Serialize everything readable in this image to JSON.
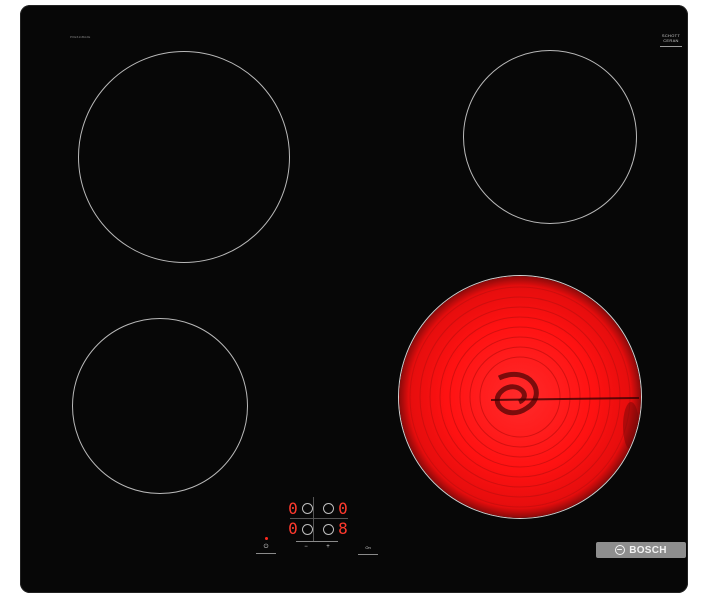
{
  "hob": {
    "model_code": "PKE611BA2E",
    "glass_brand_line1": "SCHOTT",
    "glass_brand_line2": "CERAN",
    "brand": "BOSCH",
    "heated_zone_color": "#ff1f1f"
  },
  "controls": {
    "digits": [
      "0",
      "0",
      "0",
      "8"
    ],
    "key_power": "⏻",
    "key_minus": "−",
    "key_plus": "+",
    "key_on": "On"
  }
}
